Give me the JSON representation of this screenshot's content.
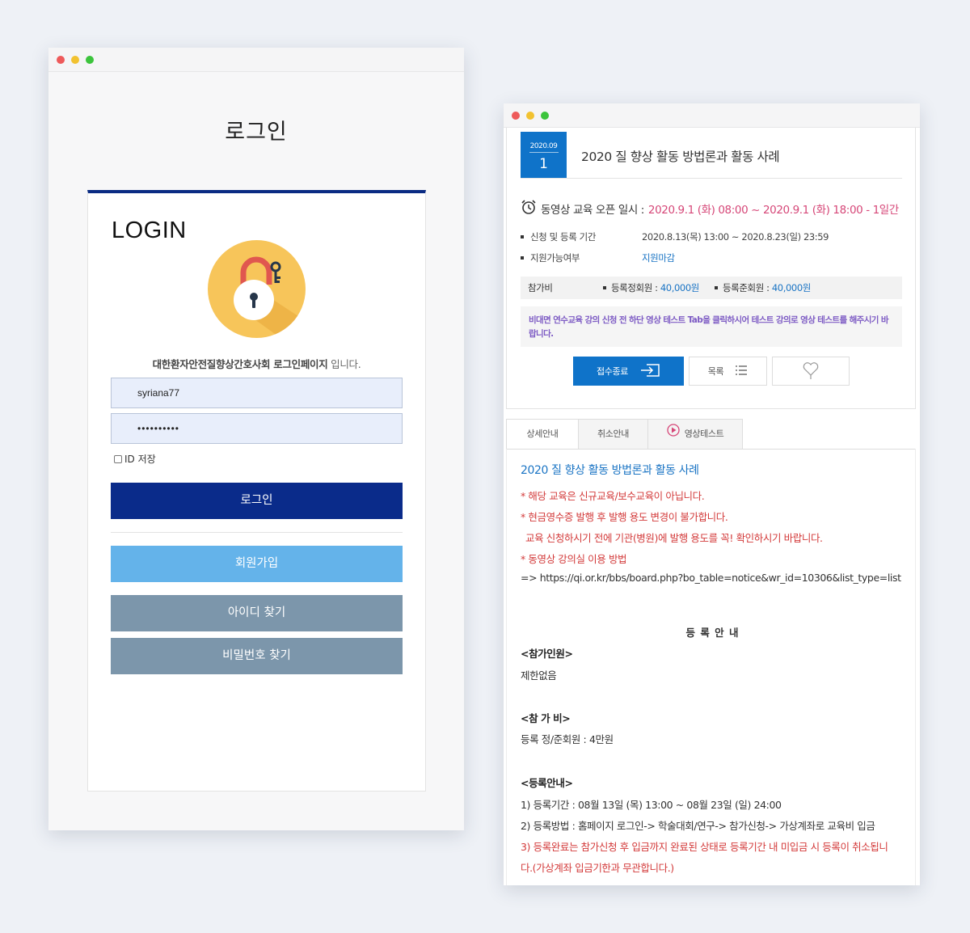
{
  "login_window": {
    "page_title": "로그인",
    "heading": "LOGIN",
    "description_bold": "대한환자안전질향상간호사회 로그인페이지",
    "description_rest": " 입니다.",
    "id_value": "syriana77",
    "password_value": "••••••••••",
    "save_id_label": "ID 저장",
    "login_button": "로그인",
    "join_button": "회원가입",
    "find_id_button": "아이디 찾기",
    "find_password_button": "비밀번호 찾기"
  },
  "course_window": {
    "date_ym": "2020.09",
    "date_day": "1",
    "title": "2020 질 향상 활동 방법론과 활동 사례",
    "open_label": "동영상 교육 오픈 일시 : ",
    "open_value": "2020.9.1 (화) 08:00 ~ 2020.9.1 (화) 18:00 - 1일간",
    "period_label": "신청 및 등록 기간",
    "period_value": "2020.8.13(목) 13:00 ~ 2020.8.23(일) 23:59",
    "support_label": "지원가능여부",
    "support_value": "지원마감",
    "fee_label": "참가비",
    "fee_regular_label": "등록정회원 : ",
    "fee_regular_value": "40,000원",
    "fee_associate_label": "등록준회원 : ",
    "fee_associate_value": "40,000원",
    "notice": "비대면 연수교육 강의 신청 전 하단 영상 테스트 Tab을 클릭하시어 테스트 강의로 영상 테스트를 해주시기 바랍니다.",
    "closed_button": "접수종료",
    "list_button": "목록",
    "tabs": [
      "상세안내",
      "취소안내",
      "영상테스트"
    ],
    "content": {
      "title": "2020 질 향상 활동 방법론과 활동 사례",
      "line1": "* 해당 교육은 신규교육/보수교육이 아닙니다.",
      "line2": "* 현금영수증 발행 후 발행 용도 변경이 불가합니다.",
      "line3": "교육 신청하시기 전에 기관(병원)에 발행 용도를 꼭! 확인하시기 바랍니다.",
      "line4": "* 동영상 강의실 이용 방법",
      "line5": "=> https://qi.or.kr/bbs/board.php?bo_table=notice&wr_id=10306&list_type=list",
      "reg_title": "등 록 안 내",
      "participants_title": "<참가인원>",
      "participants_value": "제한없음",
      "fee_title": "<참 가 비>",
      "fee_value": "등록 정/준회원 : 4만원",
      "reg_info_title": "<등록안내>",
      "reg1": "1) 등록기간 : 08월 13일 (목) 13:00 ~ 08월 23일 (일) 24:00",
      "reg2": "2) 등록방법 : 홈페이지 로그인-> 학술대회/연구-> 참가신청-> 가상계좌로 교육비 입금",
      "reg3a": "3) 등록완료는 참가신청 후 입금까지 완료된 상태로 등록기간 내 미입금 시 등록이 취소됩니",
      "reg3b": "다.(가상계좌 입금기한과 무관합니다.)"
    }
  },
  "colors": {
    "navy": "#0a2b8a",
    "blue": "#0f73c9",
    "sky": "#64b3ea",
    "steel": "#7c96ab",
    "pink": "#d64778",
    "purple": "#7d5bc4"
  }
}
